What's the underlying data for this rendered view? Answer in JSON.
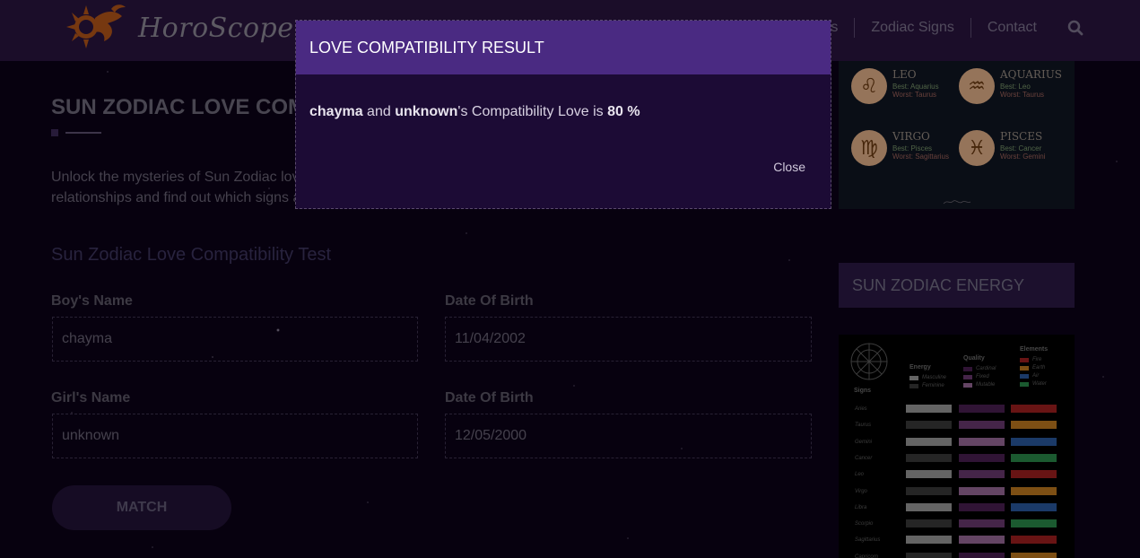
{
  "header": {
    "logo_text": "HoroScope",
    "nav": [
      {
        "label": "s"
      },
      {
        "label": "Zodiac Signs"
      },
      {
        "label": "Contact"
      }
    ]
  },
  "main": {
    "title": "SUN ZODIAC LOVE COMPATIBILITY",
    "intro_line1": "Unlock the mysteries of Sun Zodiac love",
    "intro_line2": "relationships and find out which signs are",
    "form_title": "Sun Zodiac Love Compatibility Test",
    "boy_name_label": "Boy's Name",
    "boy_name_value": "chayma",
    "boy_dob_label": "Date Of Birth",
    "boy_dob_value": "11/04/2002",
    "girl_name_label": "Girl's Name",
    "girl_name_value": "unknown",
    "girl_dob_label": "Date Of Birth",
    "girl_dob_value": "12/05/2000",
    "match_label": "MATCH"
  },
  "sidebar": {
    "signs": [
      {
        "name": "LEO",
        "glyph": "♌",
        "best": "Best: Aquarius",
        "worst": "Worst: Taurus"
      },
      {
        "name": "AQUARIUS",
        "glyph": "♒",
        "best": "Best: Leo",
        "worst": "Worst: Taurus"
      },
      {
        "name": "VIRGO",
        "glyph": "♍",
        "best": "Best: Pisces",
        "worst": "Worst: Sagittarius"
      },
      {
        "name": "PISCES",
        "glyph": "♓",
        "best": "Best: Cancer",
        "worst": "Worst: Gemini"
      }
    ],
    "energy_title": "SUN ZODIAC ENERGY",
    "chart": {
      "signs_label": "Signs",
      "energy_label": "Energy",
      "quality_label": "Quality",
      "elements_label": "Elements",
      "energy_legend": [
        "Masculine",
        "Feminine"
      ],
      "quality_legend": [
        "Cardinal",
        "Fixed",
        "Mutable"
      ],
      "elements_legend": [
        "Fire",
        "Earth",
        "Air",
        "Water"
      ],
      "rows": [
        {
          "sign": "Aries",
          "energy": "#9a9a9a",
          "quality": "#4a2052",
          "element": "#a02020"
        },
        {
          "sign": "Taurus",
          "energy": "#3a3a3a",
          "quality": "#6a3a70",
          "element": "#c07a20"
        },
        {
          "sign": "Gemini",
          "energy": "#9a9a9a",
          "quality": "#9a6a9a",
          "element": "#2a5aa0"
        },
        {
          "sign": "Cancer",
          "energy": "#3a3a3a",
          "quality": "#4a2052",
          "element": "#2a8a4a"
        },
        {
          "sign": "Leo",
          "energy": "#9a9a9a",
          "quality": "#6a3a70",
          "element": "#a02020"
        },
        {
          "sign": "Virgo",
          "energy": "#3a3a3a",
          "quality": "#9a6a9a",
          "element": "#c07a20"
        },
        {
          "sign": "Libra",
          "energy": "#9a9a9a",
          "quality": "#4a2052",
          "element": "#2a5aa0"
        },
        {
          "sign": "Scorpio",
          "energy": "#3a3a3a",
          "quality": "#6a3a70",
          "element": "#2a8a4a"
        },
        {
          "sign": "Sagittarius",
          "energy": "#9a9a9a",
          "quality": "#9a6a9a",
          "element": "#a02020"
        },
        {
          "sign": "Capricorn",
          "energy": "#3a3a3a",
          "quality": "#4a2052",
          "element": "#c07a20"
        }
      ]
    }
  },
  "modal": {
    "title": "LOVE COMPATIBILITY RESULT",
    "name1": "chayma",
    "connector": " and ",
    "name2": "unknown",
    "suffix": "'s Compatibility Love is ",
    "score": "80 %",
    "close_label": "Close"
  }
}
